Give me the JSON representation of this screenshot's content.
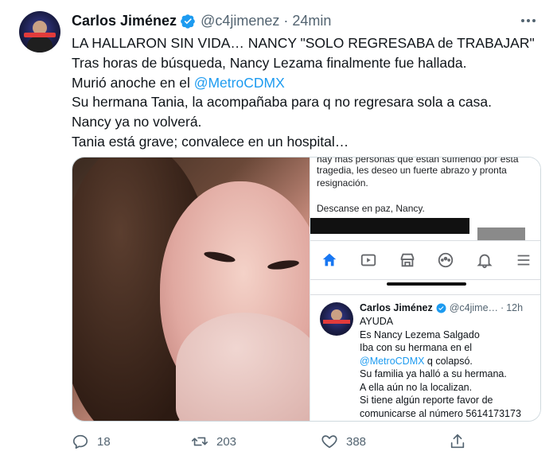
{
  "tweet": {
    "author_name": "Carlos Jiménez",
    "handle": "@c4jimenez",
    "separator": "·",
    "time": "24min",
    "lines": [
      {
        "text": "LA HALLARON SIN VIDA… NANCY \"SOLO REGRESABA de TRABAJAR\""
      },
      {
        "text": "Tras horas de búsqueda, Nancy Lezama finalmente fue hallada."
      },
      {
        "prefix": "Murió anoche en el ",
        "mention": "@MetroCDMX"
      },
      {
        "text": "Su hermana Tania, la acompañaba para q no regresara sola a casa."
      },
      {
        "text": "Nancy ya no volverá."
      },
      {
        "text": "Tania está grave; convalece en un hospital…"
      }
    ]
  },
  "screenshot": {
    "fb_text": {
      "cut_line": "hay más personas que están sufriendo por esta",
      "line2": "tragedia, les deseo un fuerte abrazo y pronta",
      "line3": "resignación.",
      "line4": "Descanse en paz, Nancy."
    },
    "quoted_tweet": {
      "author_name": "Carlos Jiménez",
      "handle": "@c4jime…",
      "separator": "·",
      "time": "12h",
      "lines": [
        {
          "text": "AYUDA"
        },
        {
          "text": "Es Nancy Lezema Salgado"
        },
        {
          "text": "Iba con su hermana en el"
        },
        {
          "prefix": "",
          "mention": "@MetroCDMX",
          "suffix": " q colapsó."
        },
        {
          "text": "Su familia ya halló a su hermana."
        },
        {
          "text": "A ella aún no la localizan."
        },
        {
          "text": "Si tiene algún reporte favor de"
        },
        {
          "text": "comunicarse al número 5614173173"
        }
      ]
    }
  },
  "actions": {
    "replies": "18",
    "retweets": "203",
    "likes": "388"
  },
  "colors": {
    "accent": "#1d9bf0",
    "muted": "#536471",
    "text": "#0f1419"
  }
}
